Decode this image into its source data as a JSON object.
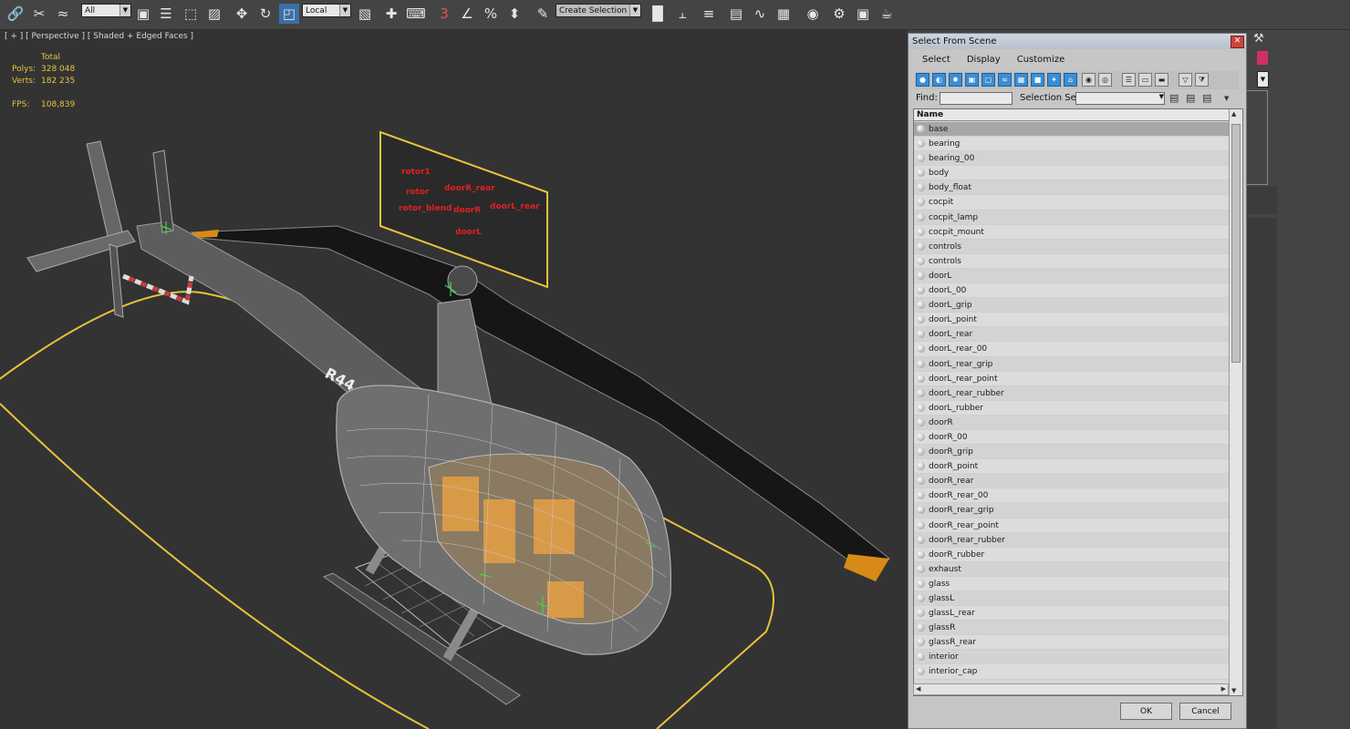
{
  "toolbar": {
    "filter_value": "All",
    "coord_value": "Local",
    "selection_set_placeholder": "Create Selection Se",
    "icons": [
      "link-icon",
      "unlink-icon",
      "bind-space-warp-icon",
      "select-icon",
      "select-by-name-icon",
      "rect-selection-icon",
      "window-crossing-icon",
      "move-icon",
      "rotate-icon",
      "scale-icon",
      "pivot-icon",
      "select-manipulate-icon",
      "keyboard-shortcut-icon",
      "snap-3d-icon",
      "angle-snap-icon",
      "percent-snap-icon",
      "spinner-snap-icon",
      "edit-named-selection-icon",
      "mirror-icon",
      "align-icon",
      "layer-manager-icon",
      "scene-explorer-icon",
      "curve-editor-icon",
      "schematic-view-icon",
      "material-editor-icon",
      "render-setup-icon",
      "render-frame-icon",
      "render-icon",
      "teapot-icon"
    ]
  },
  "viewport": {
    "label": "[ + ] [ Perspective ] [ Shaded + Edged Faces ]",
    "stats": {
      "total_label": "Total",
      "polys_label": "Polys:",
      "polys_value": "328 048",
      "verts_label": "Verts:",
      "verts_value": "182 235",
      "fps_label": "FPS:",
      "fps_value": "108,839"
    },
    "tail_text": "R44",
    "panel_labels": [
      "rotor1",
      "rotor",
      "rotor_blend",
      "doorR_rear",
      "doorL_rear",
      "doorR",
      "doorL"
    ]
  },
  "dialog": {
    "title": "Select From Scene",
    "menu": [
      "Select",
      "Display",
      "Customize"
    ],
    "find_label": "Find:",
    "selection_set_label": "Selection Set:",
    "column_name": "Name",
    "items": [
      "base",
      "bearing",
      "bearing_00",
      "body",
      "body_float",
      "cocpit",
      "cocpit_lamp",
      "cocpit_mount",
      "controls",
      "controls",
      "doorL",
      "doorL_00",
      "doorL_grip",
      "doorL_point",
      "doorL_rear",
      "doorL_rear_00",
      "doorL_rear_grip",
      "doorL_rear_point",
      "doorL_rear_rubber",
      "doorL_rubber",
      "doorR",
      "doorR_00",
      "doorR_grip",
      "doorR_point",
      "doorR_rear",
      "doorR_rear_00",
      "doorR_rear_grip",
      "doorR_rear_point",
      "doorR_rear_rubber",
      "doorR_rubber",
      "exhaust",
      "glass",
      "glassL",
      "glassL_rear",
      "glassR",
      "glassR_rear",
      "interior",
      "interior_cap"
    ],
    "selected_item": "base",
    "ok_label": "OK",
    "cancel_label": "Cancel"
  }
}
